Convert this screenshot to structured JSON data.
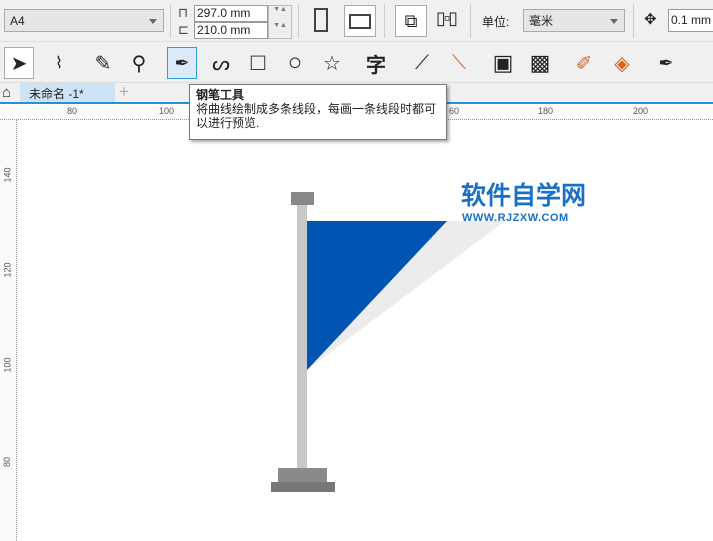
{
  "toolbar": {
    "page_size": "A4",
    "width": "297.0 mm",
    "height": "210.0 mm",
    "unit_label": "单位:",
    "unit": "毫米",
    "nudge": "0.1 mm"
  },
  "tools": [
    "pick-tool",
    "shape-tool",
    "crop-tool",
    "zoom-tool",
    "pen-tool",
    "curve-tool",
    "rectangle-tool",
    "ellipse-tool",
    "star-tool",
    "text-tool",
    "dimension-tool",
    "connector-tool",
    "contour-tool",
    "transparency-tool",
    "eyedropper-tool",
    "fill-tool",
    "pen-outline-tool"
  ],
  "tabs": {
    "doc": "未命名 -1*",
    "add": "+"
  },
  "tooltip": {
    "title": "钢笔工具",
    "body": "将曲线绘制成多条线段，每画一条线段时都可以进行预览."
  },
  "ruler": {
    "h": [
      "80",
      "100",
      "60",
      "180",
      "200"
    ],
    "v": [
      "140",
      "120",
      "100",
      "80"
    ]
  },
  "watermark": {
    "title": "软件自学网",
    "url": "WWW.RJZXW.COM"
  },
  "colors": {
    "flag": "#0055b3",
    "accent": "#2b8fd6"
  }
}
